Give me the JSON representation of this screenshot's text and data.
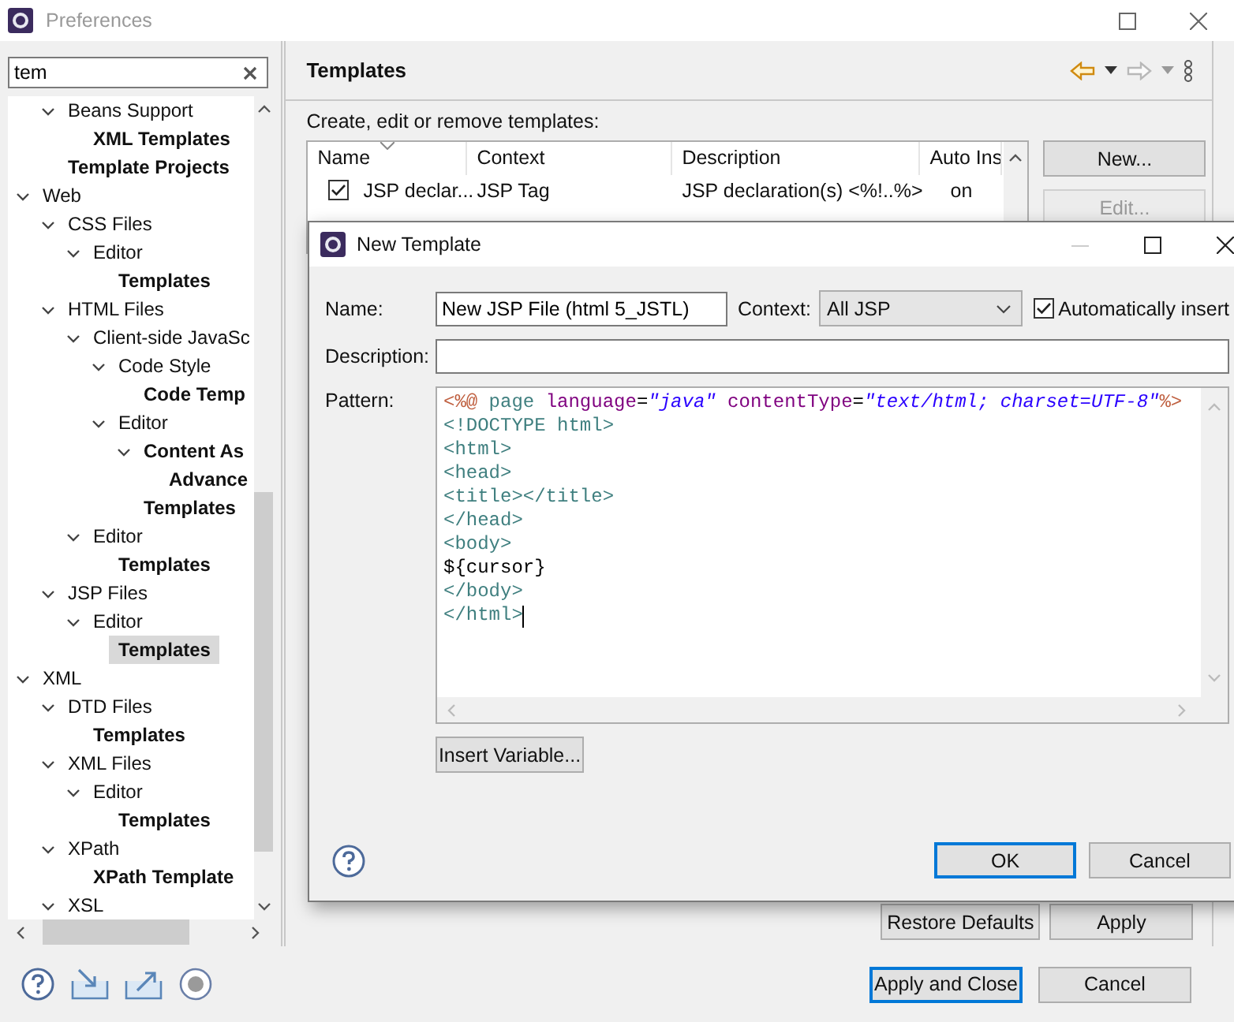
{
  "window": {
    "title": "Preferences"
  },
  "sidebar": {
    "search": {
      "value": "tem"
    },
    "tree": [
      {
        "children": [
          {
            "label": "Beans Support",
            "bold": false,
            "selected": false,
            "expanded": true,
            "children": [
              {
                "label": "XML Templates",
                "bold": true,
                "selected": false
              }
            ]
          },
          {
            "label": "Template Projects",
            "bold": true,
            "selected": false
          }
        ]
      },
      {
        "label": "Web",
        "bold": false,
        "selected": false,
        "expanded": true,
        "children": [
          {
            "label": "CSS Files",
            "bold": false,
            "selected": false,
            "expanded": true,
            "children": [
              {
                "label": "Editor",
                "bold": false,
                "selected": false,
                "expanded": true,
                "children": [
                  {
                    "label": "Templates",
                    "bold": true,
                    "selected": false
                  }
                ]
              }
            ]
          },
          {
            "label": "HTML Files",
            "bold": false,
            "selected": false,
            "expanded": true,
            "children": [
              {
                "label": "Client-side JavaSc",
                "bold": false,
                "selected": false,
                "expanded": true,
                "children": [
                  {
                    "label": "Code Style",
                    "bold": false,
                    "selected": false,
                    "expanded": true,
                    "children": [
                      {
                        "label": "Code Temp",
                        "bold": true,
                        "selected": false
                      }
                    ]
                  },
                  {
                    "label": "Editor",
                    "bold": false,
                    "selected": false,
                    "expanded": true,
                    "children": [
                      {
                        "label": "Content As",
                        "bold": true,
                        "selected": false,
                        "expanded": true,
                        "children": [
                          {
                            "label": "Advance",
                            "bold": true,
                            "selected": false
                          }
                        ]
                      },
                      {
                        "label": "Templates",
                        "bold": true,
                        "selected": false
                      }
                    ]
                  }
                ]
              },
              {
                "label": "Editor",
                "bold": false,
                "selected": false,
                "expanded": true,
                "children": [
                  {
                    "label": "Templates",
                    "bold": true,
                    "selected": false
                  }
                ]
              }
            ]
          },
          {
            "label": "JSP Files",
            "bold": false,
            "selected": false,
            "expanded": true,
            "children": [
              {
                "label": "Editor",
                "bold": false,
                "selected": false,
                "expanded": true,
                "children": [
                  {
                    "label": "Templates",
                    "bold": true,
                    "selected": true
                  }
                ]
              }
            ]
          }
        ]
      },
      {
        "label": "XML",
        "bold": false,
        "selected": false,
        "expanded": true,
        "children": [
          {
            "label": "DTD Files",
            "bold": false,
            "selected": false,
            "expanded": true,
            "children": [
              {
                "label": "Templates",
                "bold": true,
                "selected": false
              }
            ]
          },
          {
            "label": "XML Files",
            "bold": false,
            "selected": false,
            "expanded": true,
            "children": [
              {
                "label": "Editor",
                "bold": false,
                "selected": false,
                "expanded": true,
                "children": [
                  {
                    "label": "Templates",
                    "bold": true,
                    "selected": false
                  }
                ]
              }
            ]
          },
          {
            "label": "XPath",
            "bold": false,
            "selected": false,
            "expanded": true,
            "children": [
              {
                "label": "XPath Template",
                "bold": true,
                "selected": false
              }
            ]
          },
          {
            "label": "XSL",
            "bold": false,
            "selected": false,
            "expanded": true
          }
        ]
      }
    ]
  },
  "page": {
    "title": "Templates",
    "description": "Create, edit or remove templates:",
    "table": {
      "columns": [
        "Name",
        "Context",
        "Description",
        "Auto Ins"
      ],
      "rows": [
        {
          "checked": true,
          "cells": [
            "JSP declar...",
            "JSP Tag",
            "JSP declaration(s)  <%!..%>",
            "on"
          ]
        }
      ]
    },
    "side_buttons": [
      {
        "label": "New...",
        "disabled": false
      },
      {
        "label": "Edit...",
        "disabled": true
      }
    ],
    "buttons": [
      "Restore Defaults",
      "Apply"
    ]
  },
  "footer_buttons": [
    {
      "label": "Apply and Close",
      "default": true
    },
    {
      "label": "Cancel",
      "default": false
    }
  ],
  "dialog": {
    "title": "New Template",
    "name_label": "Name:",
    "name": "New JSP File (html 5_JSTL)",
    "context_label": "Context:",
    "context": "All JSP",
    "auto_insert": {
      "label": "Automatically insert",
      "checked": true
    },
    "description_label": "Description:",
    "pattern_label": "Pattern:",
    "pattern": [
      [
        {
          "text": "<%@",
          "kind": "delim"
        },
        {
          "text": " page",
          "kind": "tag"
        },
        {
          "text": " language",
          "kind": "attr"
        },
        {
          "text": "=",
          "kind": "plain"
        },
        {
          "text": "\"java\"",
          "kind": "value"
        },
        {
          "text": " contentType",
          "kind": "attr"
        },
        {
          "text": "=",
          "kind": "plain"
        },
        {
          "text": "\"text/html; charset=UTF-8\"",
          "kind": "value"
        },
        {
          "text": "%>",
          "kind": "delim"
        }
      ],
      [
        {
          "text": "<!DOCTYPE html>",
          "kind": "tag"
        }
      ],
      [
        {
          "text": "<html>",
          "kind": "tag"
        }
      ],
      [
        {
          "text": "<head>",
          "kind": "tag"
        }
      ],
      [
        {
          "text": "<title></title>",
          "kind": "tag"
        }
      ],
      [
        {
          "text": "</head>",
          "kind": "tag"
        }
      ],
      [
        {
          "text": "<body>",
          "kind": "tag"
        }
      ],
      [
        {
          "text": "${cursor}",
          "kind": "plain"
        }
      ],
      [
        {
          "text": "</body>",
          "kind": "tag"
        }
      ],
      [
        {
          "text": "</html>",
          "kind": "tag"
        }
      ]
    ],
    "insert_button": "Insert Variable...",
    "buttons": [
      {
        "label": "OK",
        "default": true
      },
      {
        "label": "Cancel",
        "default": false
      }
    ]
  }
}
